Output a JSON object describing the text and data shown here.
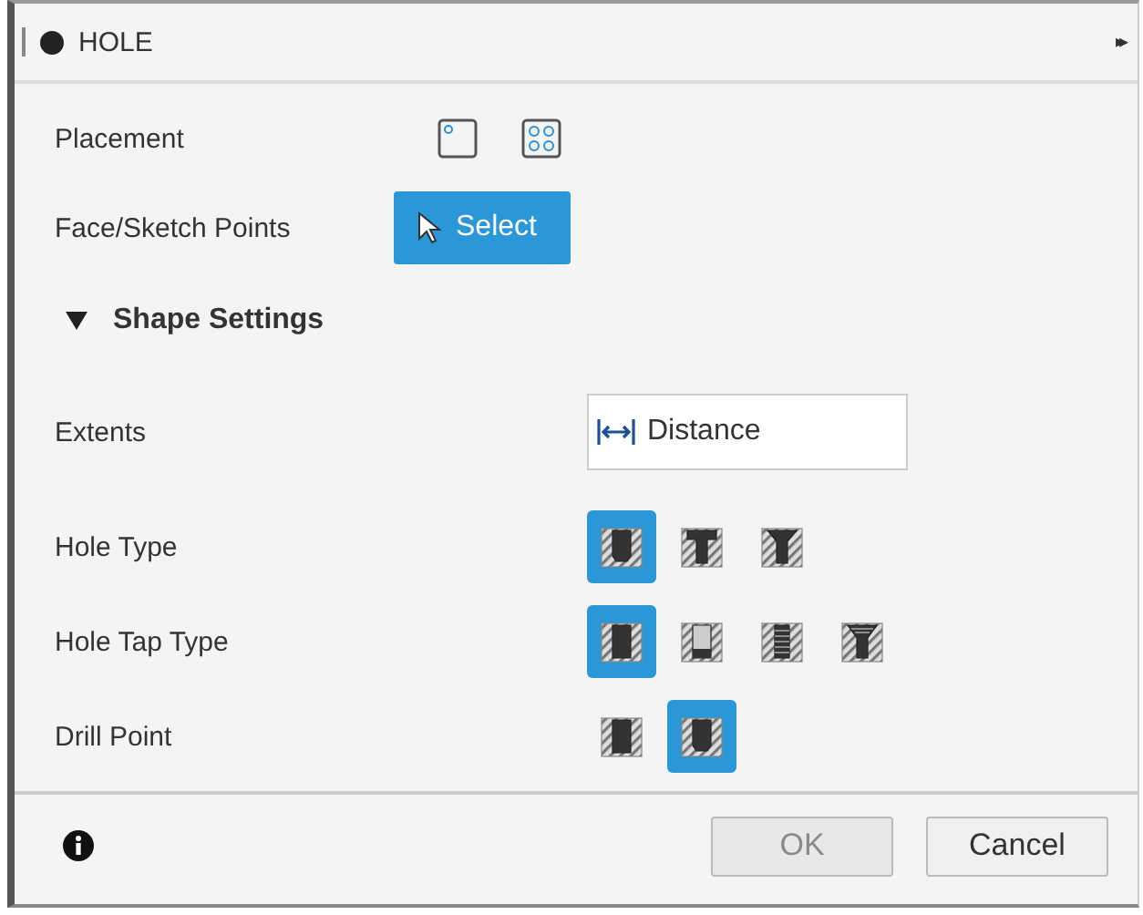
{
  "panel": {
    "title": "HOLE",
    "expand_icon": "▸▸"
  },
  "placement": {
    "label": "Placement",
    "options": [
      {
        "kind": "single",
        "selected": false
      },
      {
        "kind": "multiple",
        "selected": false
      }
    ]
  },
  "points": {
    "label": "Face/Sketch Points",
    "button": "Select"
  },
  "section": {
    "title": "Shape Settings",
    "expanded": true
  },
  "extents": {
    "label": "Extents",
    "value": "Distance"
  },
  "rows": [
    {
      "label": "Hole Type",
      "options": [
        {
          "kind": "simple",
          "selected": true
        },
        {
          "kind": "counterbore",
          "selected": false
        },
        {
          "kind": "countersink",
          "selected": false
        }
      ]
    },
    {
      "label": "Hole Tap Type",
      "options": [
        {
          "kind": "straight",
          "selected": true
        },
        {
          "kind": "clearance",
          "selected": false
        },
        {
          "kind": "tapped",
          "selected": false
        },
        {
          "kind": "taper-tapped",
          "selected": false
        }
      ]
    },
    {
      "label": "Drill Point",
      "options": [
        {
          "kind": "flat",
          "selected": false
        },
        {
          "kind": "angled",
          "selected": true
        }
      ]
    }
  ],
  "footer": {
    "ok": "OK",
    "ok_disabled": true,
    "cancel": "Cancel"
  }
}
